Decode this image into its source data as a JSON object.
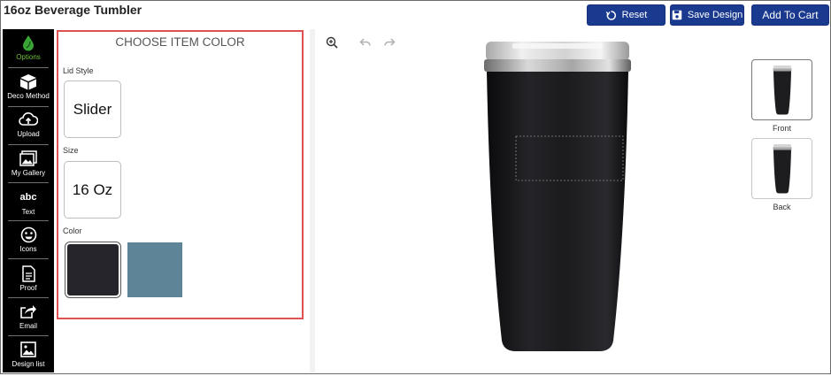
{
  "header": {
    "title": "16oz Beverage Tumbler",
    "reset_label": "Reset",
    "save_label": "Save Design",
    "cart_label": "Add To Cart"
  },
  "sidebar": {
    "items": [
      {
        "label": "Options",
        "icon": "leaf-icon",
        "active": true
      },
      {
        "label": "Deco Method",
        "icon": "box-icon"
      },
      {
        "label": "Upload",
        "icon": "cloud-upload-icon"
      },
      {
        "label": "My Gallery",
        "icon": "gallery-icon"
      },
      {
        "label": "Text",
        "icon": "text-abc-icon"
      },
      {
        "label": "Icons",
        "icon": "smiley-icon"
      },
      {
        "label": "Proof",
        "icon": "document-icon"
      },
      {
        "label": "Email",
        "icon": "share-icon"
      },
      {
        "label": "Design list",
        "icon": "image-icon"
      }
    ]
  },
  "options": {
    "title": "CHOOSE ITEM COLOR",
    "lid_label": "Lid Style",
    "lid_value": "Slider",
    "size_label": "Size",
    "size_value": "16 Oz",
    "color_label": "Color",
    "colors": [
      "#25252b",
      "#5d8597"
    ]
  },
  "views": {
    "front_label": "Front",
    "back_label": "Back"
  },
  "colors": {
    "brand": "#1a3a8f",
    "highlight": "#e05252",
    "active_nav": "#6fc23b"
  }
}
